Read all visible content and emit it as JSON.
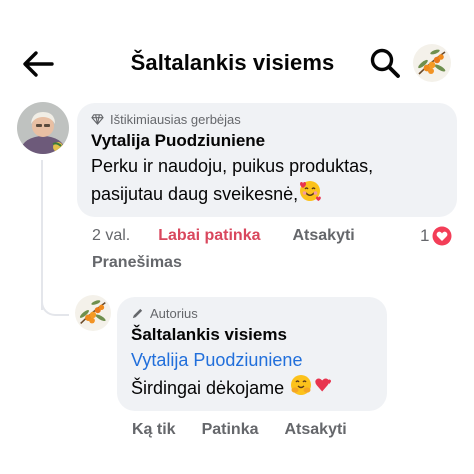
{
  "header": {
    "title": "Šaltalankis visiems",
    "back_icon": "arrow-left-icon",
    "search_icon": "search-icon"
  },
  "comment": {
    "badge": "Ištikimiausias gerbėjas",
    "badge_icon": "diamond-icon",
    "author": "Vytalija Puodziuniene",
    "text_line1": "Perku ir naudoju, puikus produktas,",
    "text_line2": "pasijutau daug sveikesnė,",
    "emoji": "smiling-face-with-hearts",
    "time": "2 val.",
    "like_label": "Labai patinka",
    "reply_label": "Atsakyti",
    "report_label": "Pranešimas",
    "reaction_count": "1",
    "reaction_icon": "love-reaction-icon"
  },
  "reply": {
    "badge": "Autorius",
    "badge_icon": "pencil-icon",
    "author": "Šaltalankis visiems",
    "mention": "Vytalija Puodziuniene",
    "text": "Širdingai dėkojame",
    "emoji": "hugging-face-and-heart",
    "time": "Ką tik",
    "like_label": "Patinka",
    "reply_label": "Atsakyti"
  },
  "colors": {
    "bubble": "#f0f2f5",
    "liked": "#d9475d",
    "mention": "#216fdb",
    "muted": "#65676b"
  }
}
